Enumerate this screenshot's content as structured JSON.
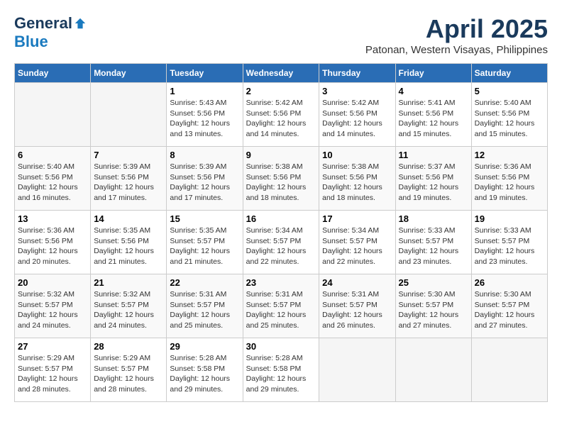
{
  "logo": {
    "general": "General",
    "blue": "Blue"
  },
  "title": {
    "month_year": "April 2025",
    "location": "Patonan, Western Visayas, Philippines"
  },
  "weekdays": [
    "Sunday",
    "Monday",
    "Tuesday",
    "Wednesday",
    "Thursday",
    "Friday",
    "Saturday"
  ],
  "weeks": [
    [
      {
        "day": "",
        "info": ""
      },
      {
        "day": "",
        "info": ""
      },
      {
        "day": "1",
        "info": "Sunrise: 5:43 AM\nSunset: 5:56 PM\nDaylight: 12 hours\nand 13 minutes."
      },
      {
        "day": "2",
        "info": "Sunrise: 5:42 AM\nSunset: 5:56 PM\nDaylight: 12 hours\nand 14 minutes."
      },
      {
        "day": "3",
        "info": "Sunrise: 5:42 AM\nSunset: 5:56 PM\nDaylight: 12 hours\nand 14 minutes."
      },
      {
        "day": "4",
        "info": "Sunrise: 5:41 AM\nSunset: 5:56 PM\nDaylight: 12 hours\nand 15 minutes."
      },
      {
        "day": "5",
        "info": "Sunrise: 5:40 AM\nSunset: 5:56 PM\nDaylight: 12 hours\nand 15 minutes."
      }
    ],
    [
      {
        "day": "6",
        "info": "Sunrise: 5:40 AM\nSunset: 5:56 PM\nDaylight: 12 hours\nand 16 minutes."
      },
      {
        "day": "7",
        "info": "Sunrise: 5:39 AM\nSunset: 5:56 PM\nDaylight: 12 hours\nand 17 minutes."
      },
      {
        "day": "8",
        "info": "Sunrise: 5:39 AM\nSunset: 5:56 PM\nDaylight: 12 hours\nand 17 minutes."
      },
      {
        "day": "9",
        "info": "Sunrise: 5:38 AM\nSunset: 5:56 PM\nDaylight: 12 hours\nand 18 minutes."
      },
      {
        "day": "10",
        "info": "Sunrise: 5:38 AM\nSunset: 5:56 PM\nDaylight: 12 hours\nand 18 minutes."
      },
      {
        "day": "11",
        "info": "Sunrise: 5:37 AM\nSunset: 5:56 PM\nDaylight: 12 hours\nand 19 minutes."
      },
      {
        "day": "12",
        "info": "Sunrise: 5:36 AM\nSunset: 5:56 PM\nDaylight: 12 hours\nand 19 minutes."
      }
    ],
    [
      {
        "day": "13",
        "info": "Sunrise: 5:36 AM\nSunset: 5:56 PM\nDaylight: 12 hours\nand 20 minutes."
      },
      {
        "day": "14",
        "info": "Sunrise: 5:35 AM\nSunset: 5:56 PM\nDaylight: 12 hours\nand 21 minutes."
      },
      {
        "day": "15",
        "info": "Sunrise: 5:35 AM\nSunset: 5:57 PM\nDaylight: 12 hours\nand 21 minutes."
      },
      {
        "day": "16",
        "info": "Sunrise: 5:34 AM\nSunset: 5:57 PM\nDaylight: 12 hours\nand 22 minutes."
      },
      {
        "day": "17",
        "info": "Sunrise: 5:34 AM\nSunset: 5:57 PM\nDaylight: 12 hours\nand 22 minutes."
      },
      {
        "day": "18",
        "info": "Sunrise: 5:33 AM\nSunset: 5:57 PM\nDaylight: 12 hours\nand 23 minutes."
      },
      {
        "day": "19",
        "info": "Sunrise: 5:33 AM\nSunset: 5:57 PM\nDaylight: 12 hours\nand 23 minutes."
      }
    ],
    [
      {
        "day": "20",
        "info": "Sunrise: 5:32 AM\nSunset: 5:57 PM\nDaylight: 12 hours\nand 24 minutes."
      },
      {
        "day": "21",
        "info": "Sunrise: 5:32 AM\nSunset: 5:57 PM\nDaylight: 12 hours\nand 24 minutes."
      },
      {
        "day": "22",
        "info": "Sunrise: 5:31 AM\nSunset: 5:57 PM\nDaylight: 12 hours\nand 25 minutes."
      },
      {
        "day": "23",
        "info": "Sunrise: 5:31 AM\nSunset: 5:57 PM\nDaylight: 12 hours\nand 25 minutes."
      },
      {
        "day": "24",
        "info": "Sunrise: 5:31 AM\nSunset: 5:57 PM\nDaylight: 12 hours\nand 26 minutes."
      },
      {
        "day": "25",
        "info": "Sunrise: 5:30 AM\nSunset: 5:57 PM\nDaylight: 12 hours\nand 27 minutes."
      },
      {
        "day": "26",
        "info": "Sunrise: 5:30 AM\nSunset: 5:57 PM\nDaylight: 12 hours\nand 27 minutes."
      }
    ],
    [
      {
        "day": "27",
        "info": "Sunrise: 5:29 AM\nSunset: 5:57 PM\nDaylight: 12 hours\nand 28 minutes."
      },
      {
        "day": "28",
        "info": "Sunrise: 5:29 AM\nSunset: 5:57 PM\nDaylight: 12 hours\nand 28 minutes."
      },
      {
        "day": "29",
        "info": "Sunrise: 5:28 AM\nSunset: 5:58 PM\nDaylight: 12 hours\nand 29 minutes."
      },
      {
        "day": "30",
        "info": "Sunrise: 5:28 AM\nSunset: 5:58 PM\nDaylight: 12 hours\nand 29 minutes."
      },
      {
        "day": "",
        "info": ""
      },
      {
        "day": "",
        "info": ""
      },
      {
        "day": "",
        "info": ""
      }
    ]
  ]
}
